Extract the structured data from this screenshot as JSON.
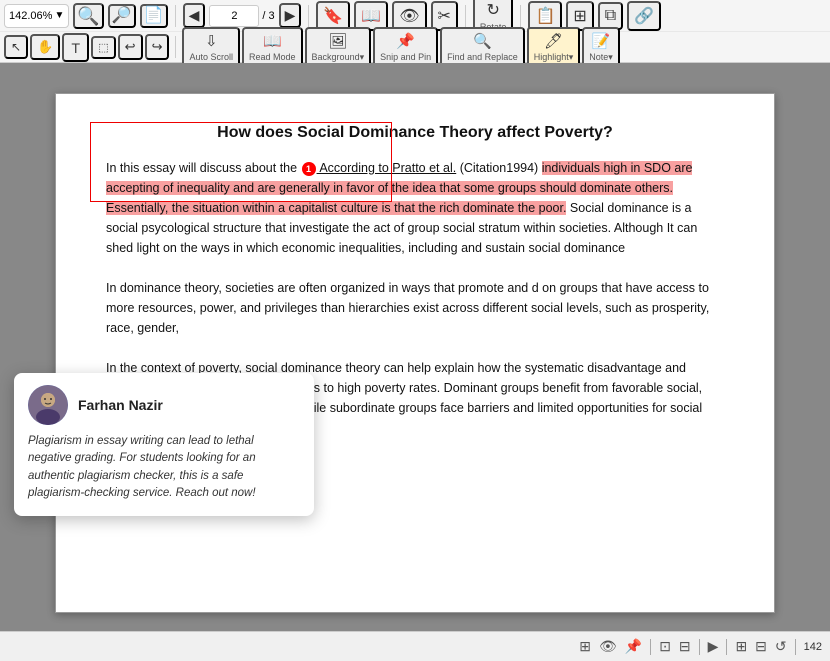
{
  "toolbar": {
    "zoom": "142.06%",
    "page_current": "2",
    "page_total": "3",
    "buttons_row1": [
      {
        "label": "",
        "icon": "🔍",
        "name": "zoom-out"
      },
      {
        "label": "",
        "icon": "🔍",
        "name": "zoom-in"
      },
      {
        "label": "",
        "icon": "📄",
        "name": "fit-page"
      },
      {
        "label": "",
        "icon": "◀",
        "name": "prev-page"
      },
      {
        "label": "",
        "icon": "▶",
        "name": "next-page"
      },
      {
        "label": "Rotate",
        "icon": "🔄",
        "name": "rotate"
      },
      {
        "label": "",
        "icon": "📋",
        "name": "copy"
      },
      {
        "label": "",
        "icon": "📑",
        "name": "split"
      },
      {
        "label": "",
        "icon": "🔗",
        "name": "link"
      }
    ],
    "buttons_row2": [
      {
        "label": "Auto Scroll",
        "icon": "⇩",
        "name": "auto-scroll"
      },
      {
        "label": "Read Mode",
        "icon": "📖",
        "name": "read-mode"
      },
      {
        "label": "Background",
        "icon": "🖼",
        "name": "background"
      },
      {
        "label": "Snip and Pin",
        "icon": "✂",
        "name": "snip-pin"
      },
      {
        "label": "Find and Replace",
        "icon": "🔍",
        "name": "find-replace"
      },
      {
        "label": "Highlight",
        "icon": "🖊",
        "name": "highlight"
      },
      {
        "label": "Note",
        "icon": "📝",
        "name": "note"
      }
    ]
  },
  "pdf": {
    "title": "How does Social Dominance Theory affect Poverty?",
    "paragraph1": "In this essay will discuss about the ",
    "cite_text": "According to Pratto et al.",
    "cite_suffix": " (Citation1994) ",
    "highlighted_text": "individuals high in SDO are accepting of inequality and are generally in favor of the idea that some groups should dominate others. Essentially, the situation within a capitalist culture is that the rich dominate the poor.",
    "after_highlight": " Social dominance is a social psycological structure that investigate  the act of group social stratum within societies. Although It can shed light on the ways in which economic inequalities, including and sustain social dominance",
    "paragraph2": "In dominance theory, societies are often organized in ways that promote and d on groups that have access to more resources, power, and privileges than hierarchies exist across different social levels, such as prosperity, race, gender,",
    "paragraph3": "In the context of poverty, social dominance theory can help explain how the systematic disadvantage and marginalization of certain groups leads to high poverty rates.  Dominant groups benefit from favorable social, economic, and political structures, while subordinate groups face barriers and limited opportunities for social mobility.",
    "annotation_number": "1"
  },
  "comment": {
    "author": "Farhan Nazir",
    "text": "Plagiarism in essay writing can lead to lethal negative grading. For students looking for an authentic plagiarism checker, this is a safe plagiarism-checking service. Reach out now!"
  },
  "status_bar": {
    "page_indicator": "142",
    "icons": [
      "save-icon",
      "eye-icon",
      "pin-icon",
      "fit-icon",
      "split-icon",
      "play-icon",
      "layout-icon",
      "resize-icon",
      "rotate-icon"
    ]
  }
}
